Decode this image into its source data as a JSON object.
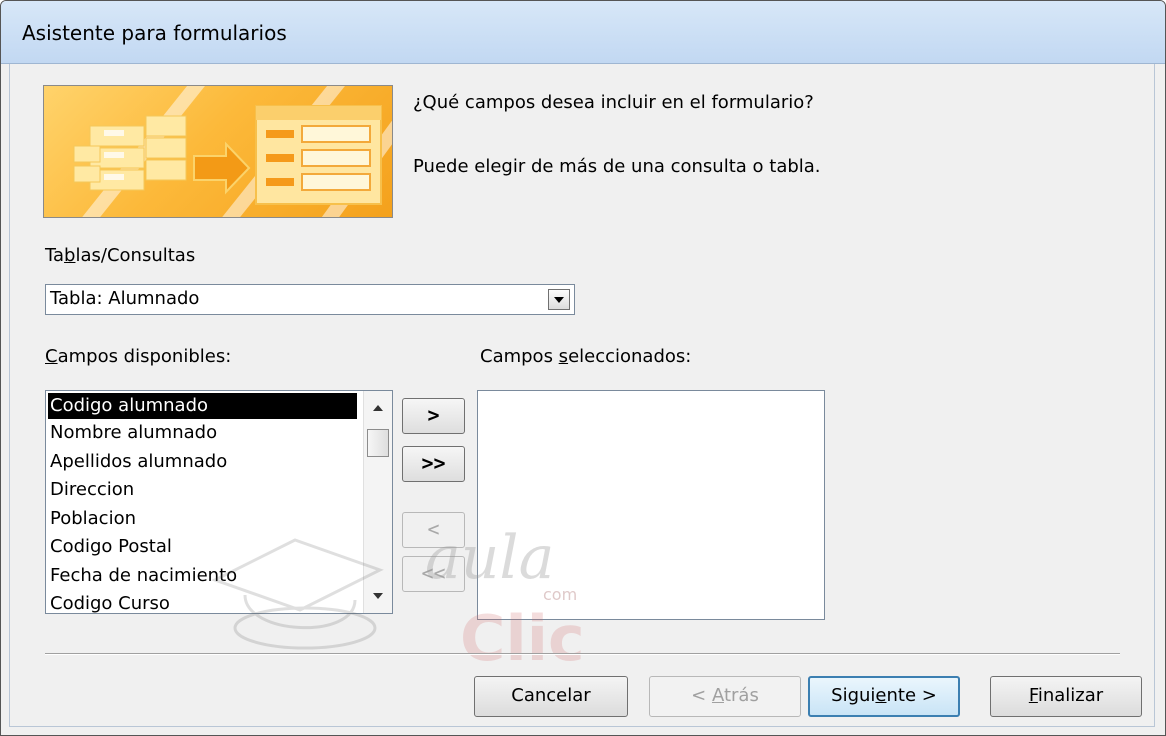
{
  "window": {
    "title": "Asistente para formularios"
  },
  "intro": {
    "question": "¿Qué campos desea incluir en el formulario?",
    "hint": "Puede elegir de más de una consulta o tabla."
  },
  "tables": {
    "label_pre": "Ta",
    "label_key": "b",
    "label_post": "las/Consultas",
    "selected": "Tabla: Alumnado"
  },
  "available": {
    "label_key": "C",
    "label_post": "ampos disponibles:",
    "items": [
      "Codigo alumnado",
      "Nombre alumnado",
      "Apellidos alumnado",
      "Direccion",
      "Poblacion",
      "Codigo Postal",
      "Fecha de nacimiento",
      "Codigo Curso"
    ],
    "selected_index": 0
  },
  "selected_fields": {
    "label_pre": "Campos ",
    "label_key": "s",
    "label_post": "eleccionados:",
    "items": []
  },
  "move_buttons": {
    "add_one": ">",
    "add_all": ">>",
    "remove_one": "<",
    "remove_all": "<<"
  },
  "footer": {
    "cancel": "Cancelar",
    "back_pre": "< ",
    "back_key": "A",
    "back_post": "trás",
    "next_pre": "Sigui",
    "next_key": "e",
    "next_post": "nte >",
    "finish_key": "F",
    "finish_post": "inalizar"
  },
  "watermark": {
    "line1": "aula",
    "line2": "Clic",
    "small": "com"
  },
  "colors": {
    "banner": "#f7b42c",
    "default_button_border": "#3c7fb1"
  }
}
